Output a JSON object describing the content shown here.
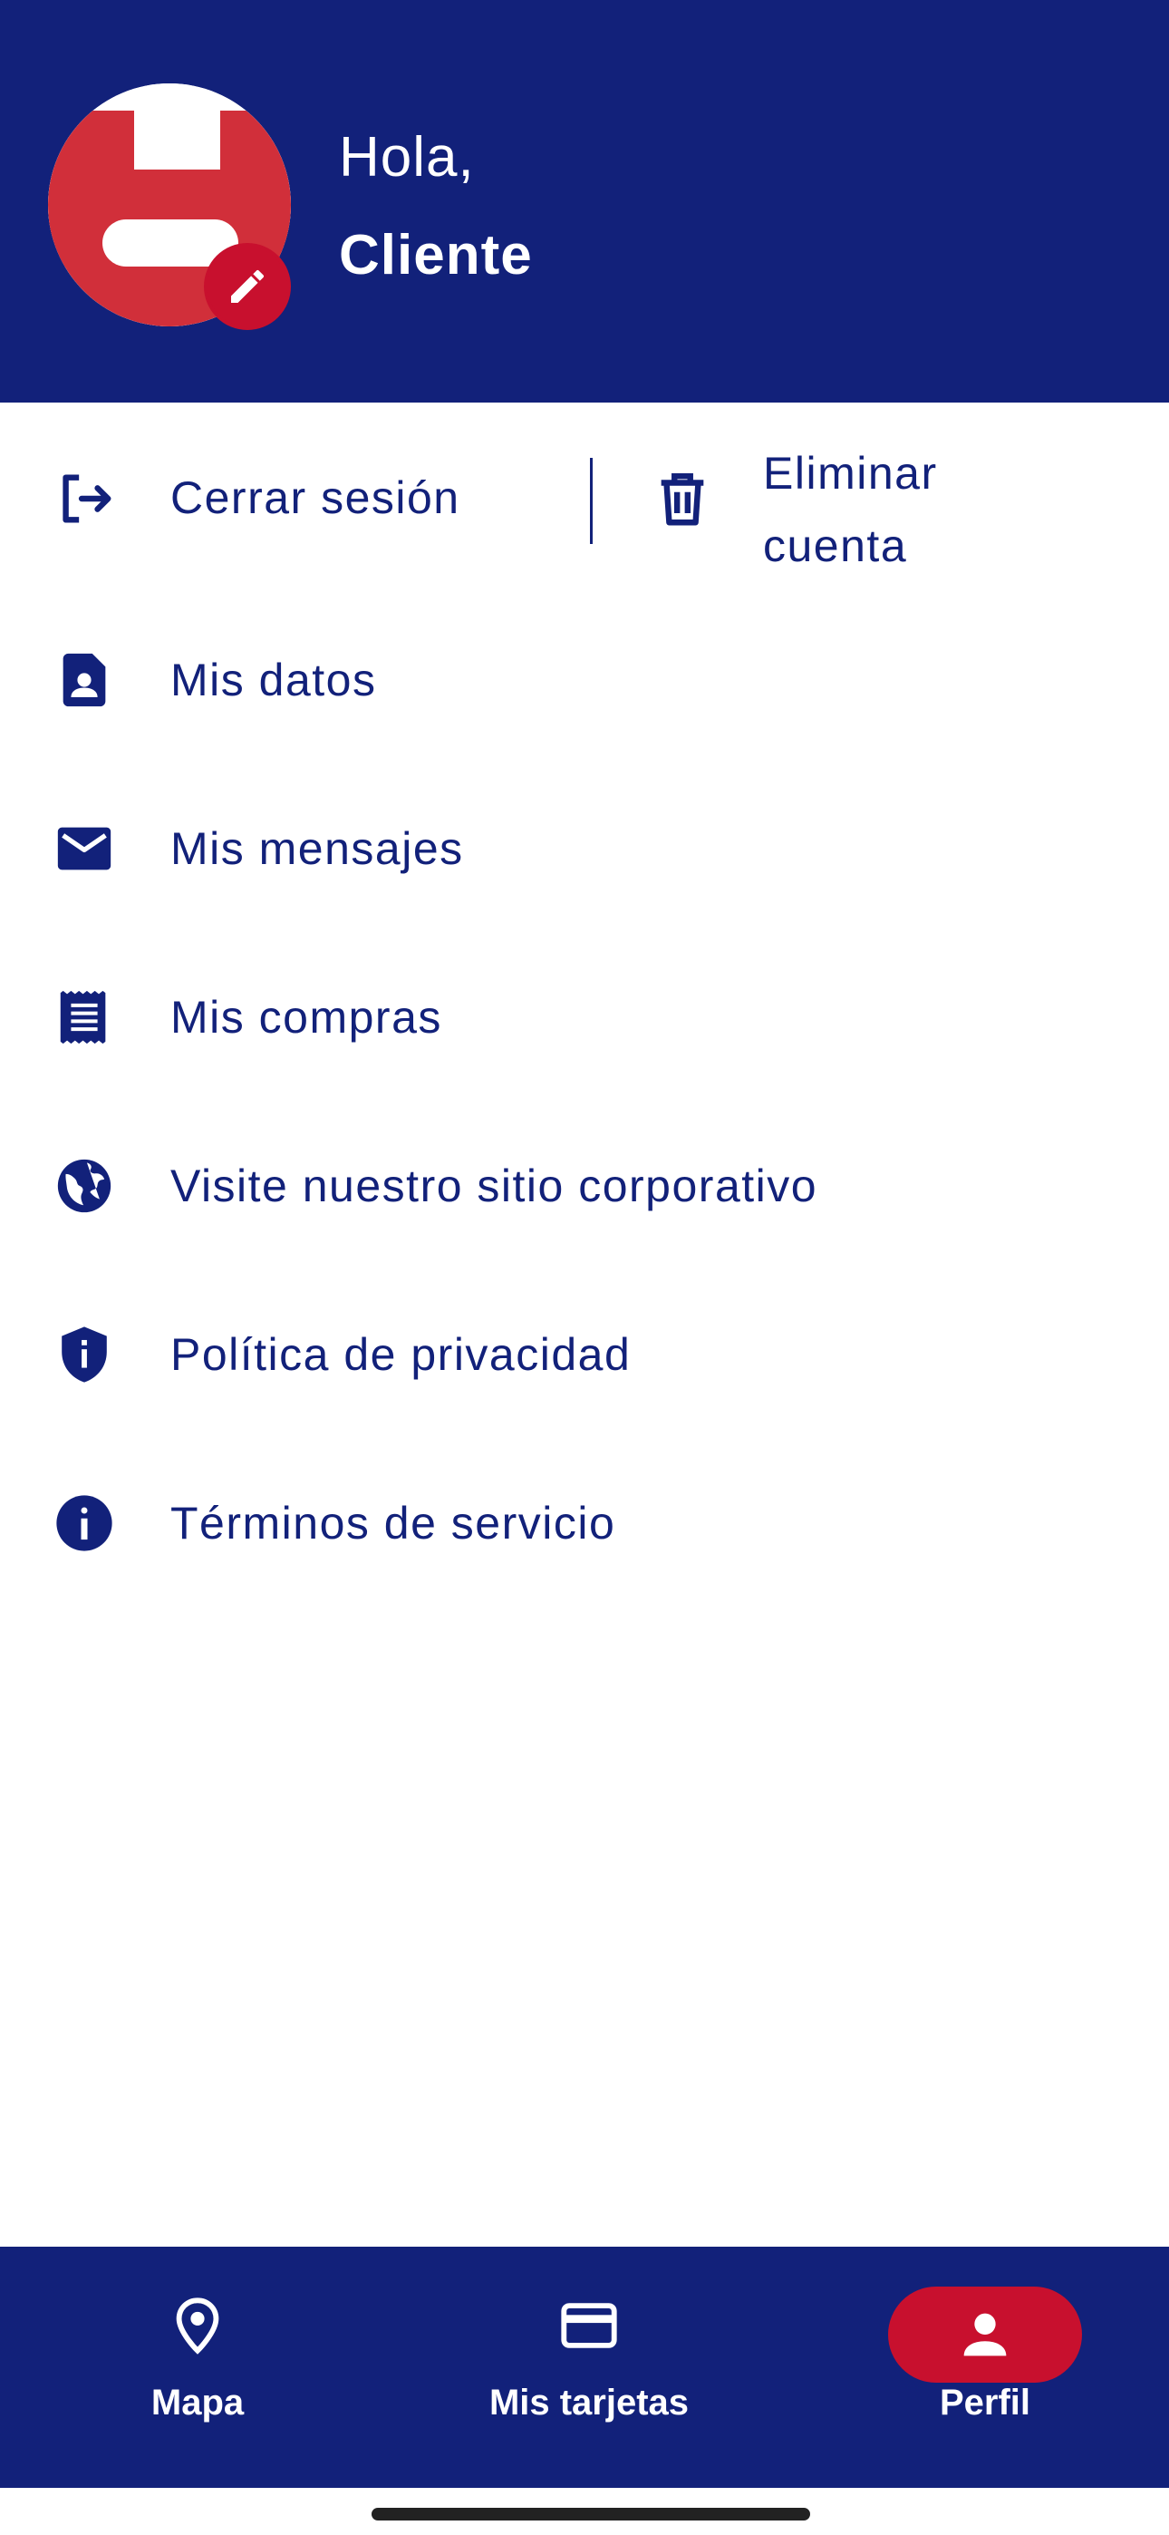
{
  "header": {
    "greeting": "Hola,",
    "user_name": "Cliente",
    "bg_color": "#12217a",
    "avatar_icon": "brand-logo",
    "edit_icon": "pencil-icon"
  },
  "account_actions": {
    "logout_label": "Cerrar sesión",
    "logout_icon": "logout-icon",
    "delete_label": "Eliminar cuenta",
    "delete_icon": "trash-icon"
  },
  "menu": {
    "items": [
      {
        "label": "Mis datos",
        "icon": "contact-card-icon"
      },
      {
        "label": "Mis mensajes",
        "icon": "mail-icon"
      },
      {
        "label": "Mis compras",
        "icon": "receipt-icon"
      },
      {
        "label": "Visite nuestro sitio corporativo",
        "icon": "globe-icon"
      },
      {
        "label": "Política de privacidad",
        "icon": "shield-icon"
      },
      {
        "label": "Términos de servicio",
        "icon": "info-icon"
      }
    ]
  },
  "bottom_nav": {
    "items": [
      {
        "label": "Mapa",
        "icon": "map-pin-icon",
        "active": false
      },
      {
        "label": "Mis tarjetas",
        "icon": "credit-card-icon",
        "active": false
      },
      {
        "label": "Perfil",
        "icon": "person-icon",
        "active": true
      }
    ]
  },
  "colors": {
    "primary": "#12217a",
    "accent": "#c8102e",
    "background": "#ffffff"
  }
}
